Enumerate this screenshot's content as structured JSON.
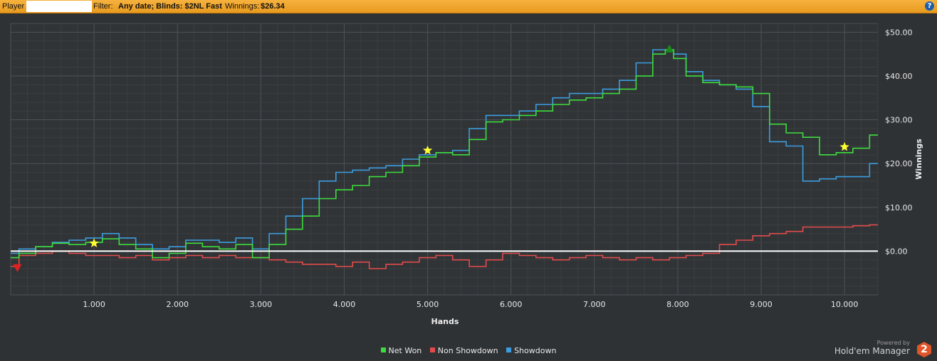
{
  "header": {
    "player_label": "Player",
    "filter_label": "Filter:",
    "filter_value": "Any date; Blinds: $2NL Fast",
    "winnings_label": "Winnings:",
    "winnings_value": "$26.34",
    "help_icon": "?"
  },
  "footer": {
    "powered_by": "Powered by",
    "brand": "Hold'em Manager",
    "brand_badge": "2"
  },
  "colors": {
    "net_won": "#3ddc3d",
    "non_showdown": "#e24b4b",
    "showdown": "#3b9de0",
    "zero_line": "#ffffff",
    "background": "#2f3235",
    "header": "#f0a830"
  },
  "chart_data": {
    "type": "line",
    "title": "",
    "xlabel": "Hands",
    "ylabel": "Winnings",
    "xlim": [
      0,
      10400
    ],
    "ylim": [
      -10,
      52
    ],
    "x_ticks": [
      1000,
      2000,
      3000,
      4000,
      5000,
      6000,
      7000,
      8000,
      9000,
      10000
    ],
    "x_tick_labels": [
      "1.000",
      "2.000",
      "3.000",
      "4.000",
      "5.000",
      "6.000",
      "7.000",
      "8.000",
      "9.000",
      "10.000"
    ],
    "y_ticks": [
      0,
      10,
      20,
      30,
      40,
      50
    ],
    "y_tick_labels": [
      "$0.00",
      "$10.00",
      "$20.00",
      "$30.00",
      "$40.00",
      "$50.00"
    ],
    "grid": true,
    "legend_position": "bottom-center",
    "series": [
      {
        "name": "Net Won",
        "color": "#3ddc3d",
        "x": [
          0,
          200,
          400,
          600,
          800,
          1000,
          1200,
          1400,
          1600,
          1800,
          2000,
          2200,
          2400,
          2600,
          2800,
          3000,
          3200,
          3400,
          3600,
          3800,
          4000,
          4200,
          4400,
          4600,
          4800,
          5000,
          5200,
          5400,
          5600,
          5800,
          6000,
          6200,
          6400,
          6600,
          6800,
          7000,
          7200,
          7400,
          7600,
          7800,
          7900,
          8000,
          8200,
          8400,
          8600,
          8800,
          9000,
          9200,
          9400,
          9600,
          9800,
          10000,
          10200,
          10400
        ],
        "y": [
          -1.5,
          -0.5,
          1.0,
          1.8,
          1.5,
          2.0,
          2.8,
          1.5,
          0.5,
          -1.5,
          -0.5,
          1.8,
          1.0,
          0.5,
          1.5,
          -1.5,
          1.5,
          5.0,
          8.0,
          12.0,
          14.0,
          15.0,
          17.0,
          18.0,
          19.5,
          21.5,
          22.5,
          22.0,
          25.5,
          29.5,
          30.0,
          31.0,
          32.0,
          33.5,
          34.5,
          35.0,
          36.0,
          37.0,
          40.0,
          45.0,
          46.0,
          44.0,
          40.0,
          38.5,
          38.0,
          37.5,
          36.0,
          29.0,
          27.0,
          26.0,
          22.0,
          22.5,
          23.5,
          26.5
        ]
      },
      {
        "name": "Non Showdown",
        "color": "#e24b4b",
        "x": [
          0,
          200,
          400,
          600,
          800,
          1000,
          1200,
          1400,
          1600,
          1800,
          2000,
          2200,
          2400,
          2600,
          2800,
          3000,
          3200,
          3400,
          3600,
          3800,
          4000,
          4200,
          4400,
          4600,
          4800,
          5000,
          5200,
          5400,
          5600,
          5800,
          6000,
          6200,
          6400,
          6600,
          6800,
          7000,
          7200,
          7400,
          7600,
          7800,
          8000,
          8200,
          8400,
          8600,
          8800,
          9000,
          9200,
          9400,
          9600,
          9800,
          10000,
          10200,
          10400
        ],
        "y": [
          -3.5,
          -1.0,
          -0.5,
          0.0,
          -0.5,
          -1.0,
          -1.0,
          -1.5,
          -1.0,
          -2.0,
          -1.5,
          -1.0,
          -1.5,
          -1.0,
          -1.5,
          -1.5,
          -2.0,
          -2.5,
          -3.0,
          -3.0,
          -3.5,
          -2.5,
          -4.0,
          -3.0,
          -2.5,
          -1.5,
          -1.0,
          -2.0,
          -3.5,
          -2.0,
          -0.5,
          -1.0,
          -1.5,
          -2.0,
          -1.5,
          -1.0,
          -1.5,
          -2.0,
          -1.5,
          -2.0,
          -1.5,
          -1.0,
          -0.5,
          1.5,
          2.5,
          3.5,
          4.0,
          4.5,
          5.5,
          5.5,
          5.5,
          5.8,
          6.0
        ]
      },
      {
        "name": "Showdown",
        "color": "#3b9de0",
        "x": [
          0,
          200,
          400,
          600,
          800,
          1000,
          1200,
          1400,
          1600,
          1800,
          2000,
          2200,
          2400,
          2600,
          2800,
          3000,
          3200,
          3400,
          3600,
          3800,
          4000,
          4200,
          4400,
          4600,
          4800,
          5000,
          5200,
          5400,
          5600,
          5800,
          6000,
          6200,
          6400,
          6600,
          6800,
          7000,
          7200,
          7400,
          7600,
          7800,
          7900,
          8000,
          8200,
          8400,
          8600,
          8800,
          9000,
          9200,
          9400,
          9600,
          9800,
          10000,
          10200,
          10400
        ],
        "y": [
          -0.5,
          0.5,
          1.0,
          2.0,
          2.5,
          3.0,
          4.0,
          3.0,
          1.5,
          0.5,
          1.0,
          2.5,
          2.5,
          2.0,
          3.0,
          0.5,
          4.0,
          8.0,
          12.0,
          16.0,
          18.0,
          18.5,
          19.0,
          19.5,
          21.0,
          22.0,
          22.5,
          23.0,
          28.0,
          31.0,
          31.0,
          32.0,
          33.5,
          35.0,
          36.0,
          36.0,
          37.0,
          39.0,
          43.0,
          46.0,
          46.0,
          45.0,
          41.0,
          39.0,
          38.0,
          37.0,
          33.0,
          25.0,
          24.0,
          16.0,
          16.5,
          17.0,
          17.0,
          20.0
        ]
      }
    ],
    "markers": [
      {
        "type": "star",
        "color": "#ffff33",
        "x": 1000,
        "y": 1.8
      },
      {
        "type": "star",
        "color": "#ffff33",
        "x": 5000,
        "y": 23.0
      },
      {
        "type": "star",
        "color": "#ffff33",
        "x": 10000,
        "y": 23.8
      },
      {
        "type": "triangle-down",
        "color": "#e02020",
        "x": 80,
        "y": -3.8
      },
      {
        "type": "triangle-up",
        "color": "#1a8a1a",
        "x": 7900,
        "y": 46.2
      }
    ]
  }
}
